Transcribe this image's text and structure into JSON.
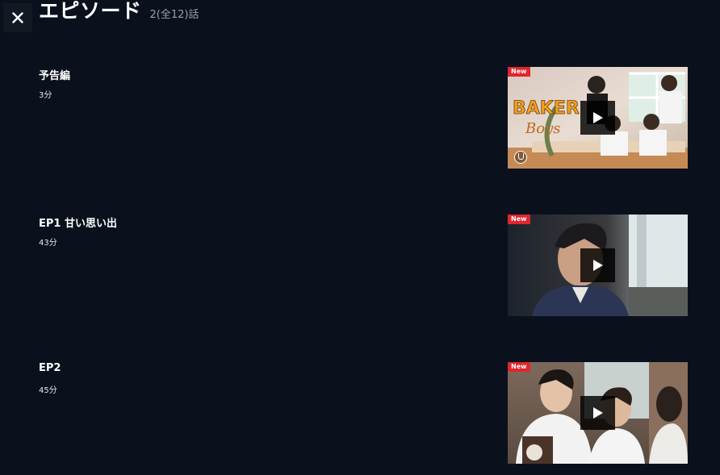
{
  "close": {
    "icon": "close-icon"
  },
  "header": {
    "title": "エピソード",
    "count": "2(全12)話"
  },
  "episodes": [
    {
      "title": "予告編",
      "duration": "3分",
      "badge": "New",
      "has_brand_mark": true
    },
    {
      "title": "EP1 甘い思い出",
      "duration": "43分",
      "badge": "New",
      "has_brand_mark": false
    },
    {
      "title": "EP2",
      "duration": "45分",
      "badge": "New",
      "has_brand_mark": false
    }
  ],
  "colors": {
    "background": "#0a111c",
    "badge": "#e0262c",
    "count_text": "#9aa1ab"
  }
}
